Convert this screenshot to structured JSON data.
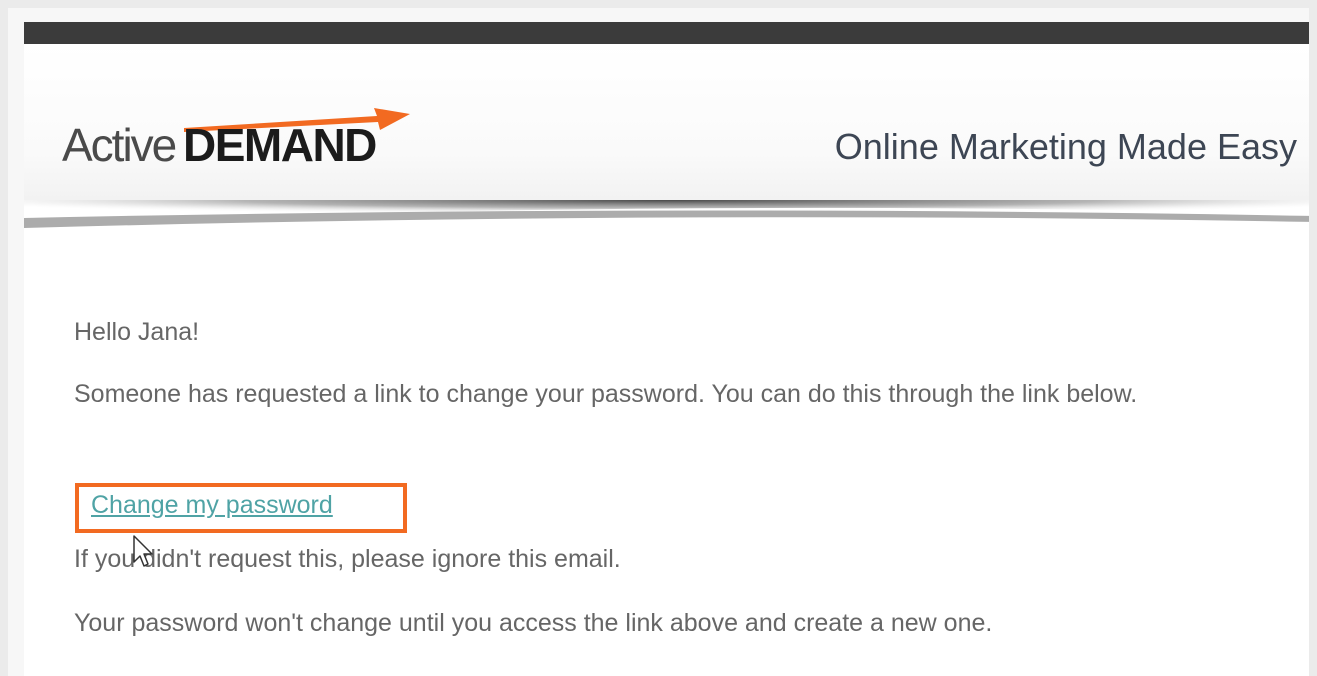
{
  "brand": {
    "logo_part1": "Active",
    "logo_part2": "DEMAND",
    "tagline": "Online Marketing Made Easy",
    "accent_color": "#f26a21"
  },
  "email": {
    "greeting": "Hello Jana!",
    "message": "Someone has requested a link to change your password. You can do this through the link below.",
    "link_label": "Change my password",
    "ignore_text": "If you didn't request this, please ignore this email.",
    "note_text": "Your password won't change until you access the link above and create a new one."
  },
  "cursor": {
    "icon": "pointer-cursor-icon"
  }
}
